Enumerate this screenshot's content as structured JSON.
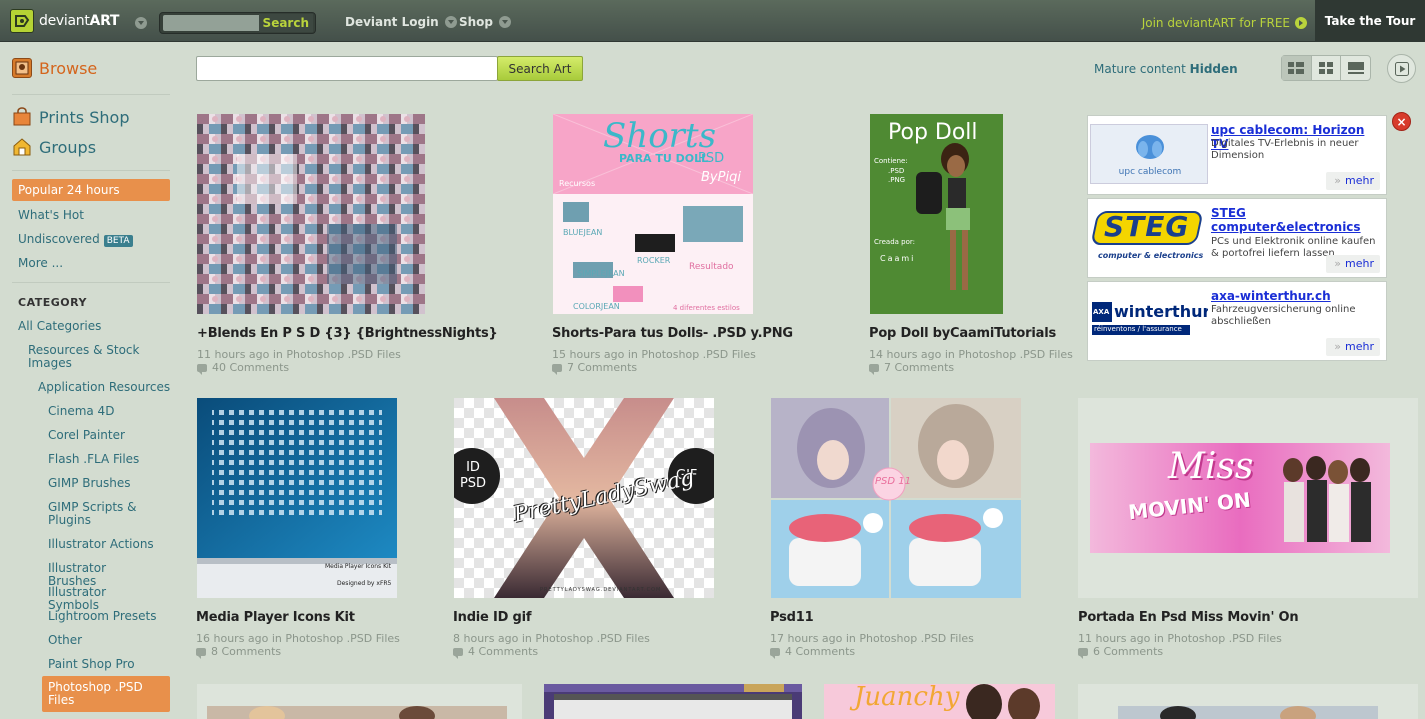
{
  "topbar": {
    "logo_text": "deviant",
    "logo_text_bold": "ART",
    "search_button": "Search",
    "search_placeholder": "",
    "nav_login": "Deviant Login",
    "nav_shop": "Shop",
    "join": "Join deviantART for FREE",
    "tour": "Take the Tour",
    "accent": "#b9d33c"
  },
  "sidebar": {
    "browse": "Browse",
    "prints": "Prints Shop",
    "groups": "Groups",
    "popular": "Popular 24 hours",
    "whats_hot": "What's Hot",
    "undiscovered": "Undiscovered",
    "beta": "BETA",
    "more": "More ...",
    "category_heading": "CATEGORY",
    "categories": [
      "All Categories",
      "Resources & Stock Images",
      "Application Resources",
      "Cinema 4D",
      "Corel Painter",
      "Flash .FLA Files",
      "GIMP Brushes",
      "GIMP Scripts & Plugins",
      "Illustrator Actions",
      "Illustrator Brushes",
      "Illustrator Symbols",
      "Lightroom Presets",
      "Other",
      "Paint Shop Pro",
      "Photoshop .PSD Files"
    ]
  },
  "main": {
    "search_button": "Search Art",
    "mature_label": "Mature content",
    "mature_value": "Hidden",
    "view_modes": [
      "list-view-icon",
      "grid-view-icon",
      "detail-view-icon"
    ],
    "active_view": 0
  },
  "deviations": [
    {
      "title": "+Blends En P S D {3} {BrightnessNights}",
      "meta": "11 hours ago in Photoshop .PSD Files",
      "comments": "40 Comments"
    },
    {
      "title": "Shorts-Para tus Dolls- .PSD y.PNG",
      "meta": "15 hours ago in Photoshop .PSD Files",
      "comments": "7 Comments",
      "art": {
        "title": "Shorts",
        "subtitle": "PARA TU DOLL",
        "psd": "PSD",
        "by": "ByPiqi",
        "recursos": "Recursos",
        "labels": [
          "BLUEJEAN",
          "ROCKER",
          "SIMPLEJEAN",
          "Resultado",
          "COLORJEAN",
          "4 diferentes estilos"
        ]
      }
    },
    {
      "title": "Pop Doll byCaamiTutorials",
      "meta": "14 hours ago in Photoshop .PSD Files",
      "comments": "7 Comments",
      "art": {
        "title": "Pop Doll",
        "contiene": "Contiene:",
        "files": [
          ".PSD",
          ".PNG"
        ],
        "creada": "Creada por:",
        "author": "Caami"
      }
    },
    {
      "title": "Media Player Icons Kit",
      "meta": "16 hours ago in Photoshop .PSD Files",
      "comments": "8 Comments",
      "art": {
        "caption": "Media Player Icons Kit",
        "by": "Designed by xFR5"
      }
    },
    {
      "title": "Indie ID gif",
      "meta": "8 hours ago in Photoshop .PSD Files",
      "comments": "4 Comments",
      "art": {
        "left": "ID PSD",
        "right": "GIF",
        "script": "PrettyLadySwag",
        "url": "PRETTYLADYSWAG.DEVIANTART.COM"
      }
    },
    {
      "title": "Psd11",
      "meta": "17 hours ago in Photoshop .PSD Files",
      "comments": "4 Comments",
      "art": {
        "badge": "PSD 11"
      }
    },
    {
      "title": "Portada En Psd Miss Movin' On",
      "meta": "11 hours ago in Photoshop .PSD Files",
      "comments": "6 Comments",
      "art": {
        "script": "Miss",
        "banner": "MOVIN' ON"
      }
    }
  ],
  "ads": [
    {
      "logo": "upc cablecom",
      "title": "upc cablecom: Horizon TV",
      "desc": "Digitales TV-Erlebnis in neuer Dimension",
      "more": "mehr"
    },
    {
      "logo": "STEG",
      "logo_sub": "computer & electronics",
      "title": "STEG computer&electronics",
      "desc": "PCs und Elektronik online kaufen & portofrei liefern lassen",
      "more": "mehr"
    },
    {
      "logo": "winterthur",
      "logo_prefix": "AXA",
      "logo_sub": "réinventons / l'assurance",
      "title": "axa-winterthur.ch",
      "desc": "Fahrzeugversicherung online abschließen",
      "more": "mehr"
    }
  ],
  "ad_close": "×",
  "partial_row": {
    "thumb3_text": "Juanchy"
  }
}
